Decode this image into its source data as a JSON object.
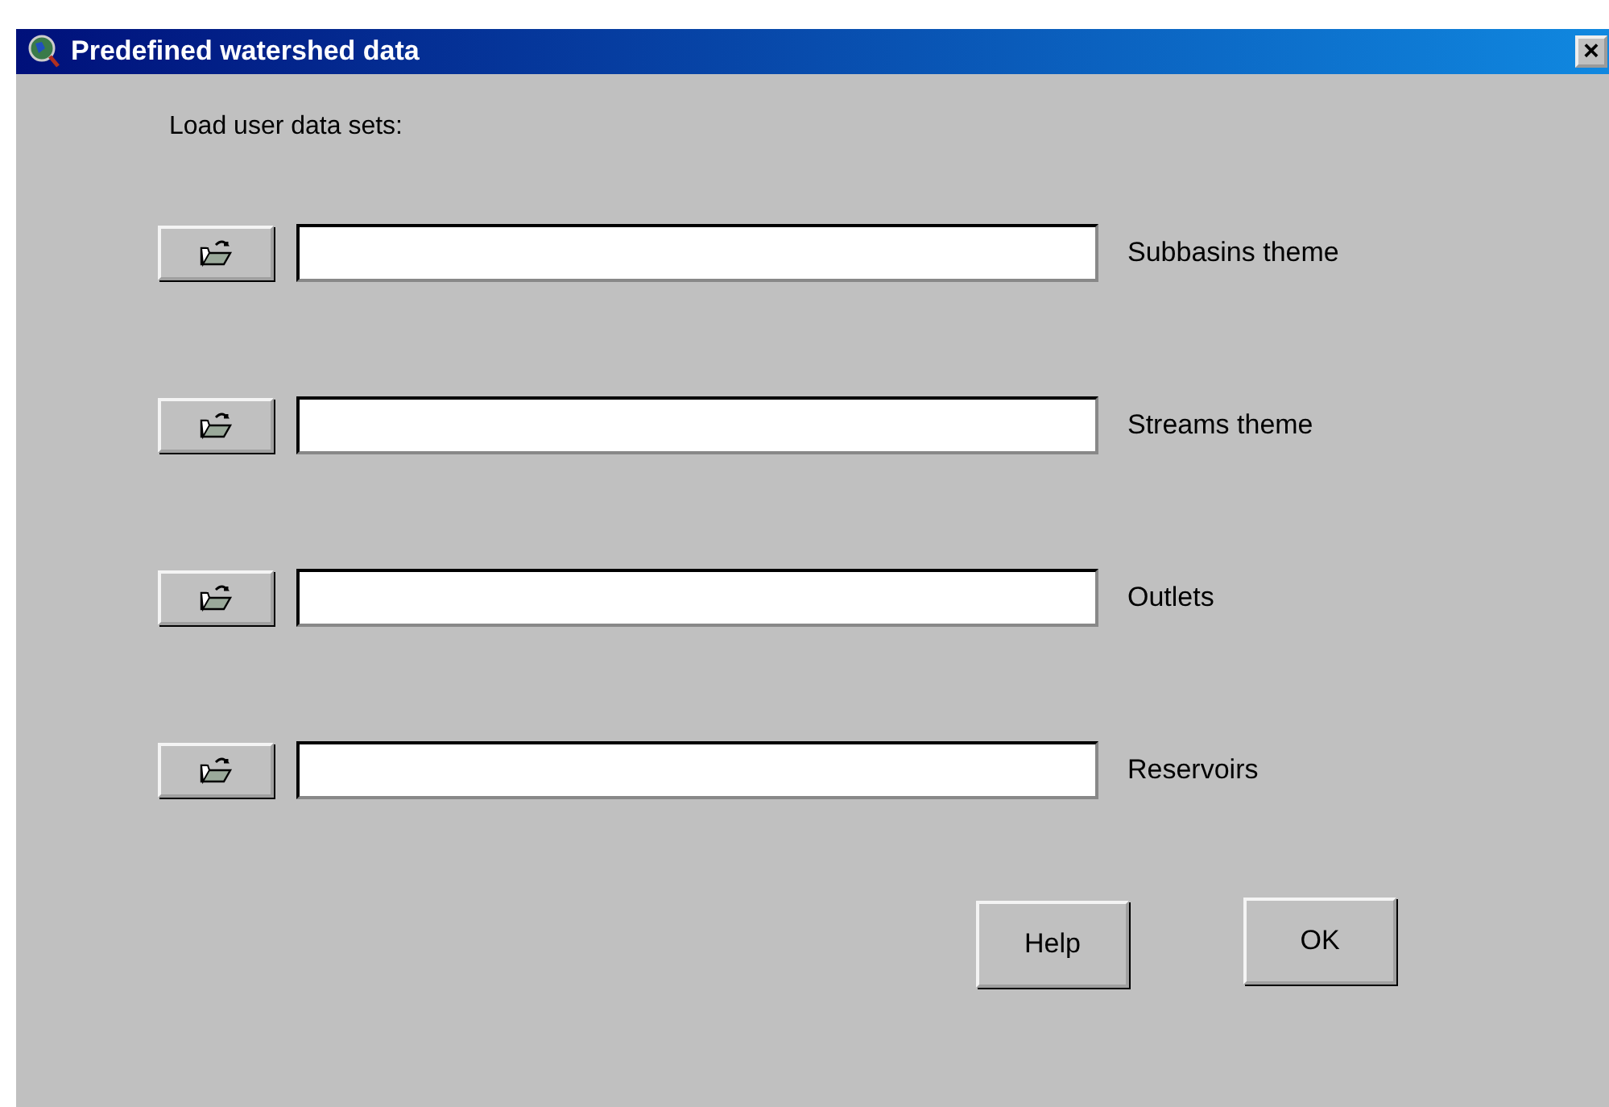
{
  "window": {
    "title": "Predefined watershed data",
    "close": "×"
  },
  "prompt": "Load user data sets:",
  "datasets": [
    {
      "label": "Subbasins theme"
    },
    {
      "label": "Streams theme"
    },
    {
      "label": "Outlets"
    },
    {
      "label": "Reservoirs"
    }
  ],
  "buttons": [
    "Help",
    "OK"
  ]
}
